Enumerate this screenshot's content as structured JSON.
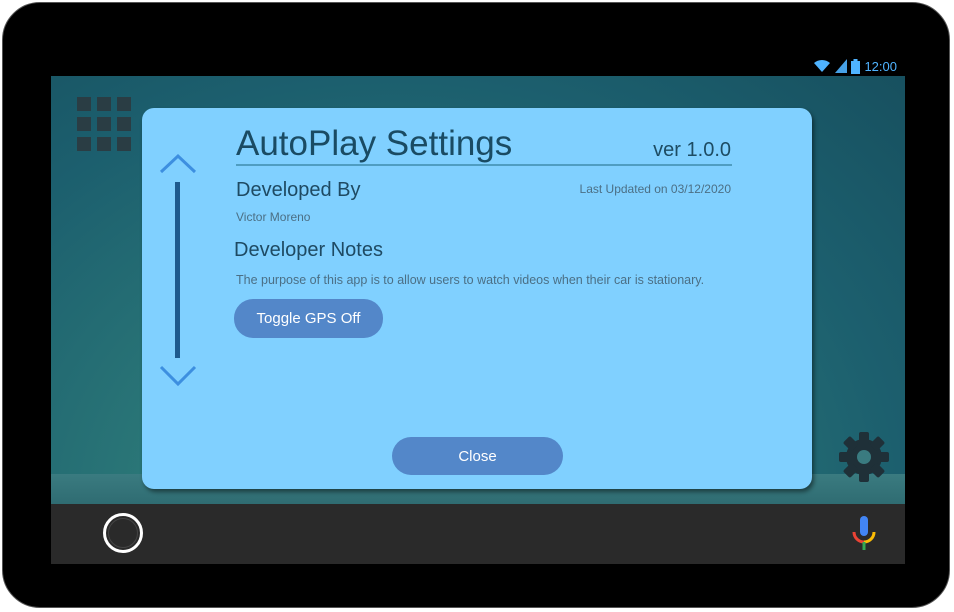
{
  "status_bar": {
    "time": "12:00",
    "icons": [
      "wifi-icon",
      "signal-icon",
      "battery-icon"
    ]
  },
  "launcher": {
    "apps_icon": "apps-grid-icon",
    "settings_icon": "gear-icon"
  },
  "navbar": {
    "home_icon": "home-circle-icon",
    "mic_icon": "mic-icon"
  },
  "dialog": {
    "title": "AutoPlay Settings",
    "version": "ver 1.0.0",
    "developed_by_label": "Developed By",
    "last_updated": "Last Updated on 03/12/2020",
    "developer_name": "Victor Moreno",
    "notes_label": "Developer Notes",
    "notes_text": "The purpose of this app is to allow users to watch videos when their car is stationary.",
    "toggle_gps_label": "Toggle GPS Off",
    "close_label": "Close",
    "scroll_up_icon": "chevron-up-icon",
    "scroll_down_icon": "chevron-down-icon"
  },
  "colors": {
    "dialog_bg": "#80d0ff",
    "button_bg": "#5387c9",
    "title_text": "#1a4b63",
    "scroll_accent": "#3d8fe0"
  }
}
